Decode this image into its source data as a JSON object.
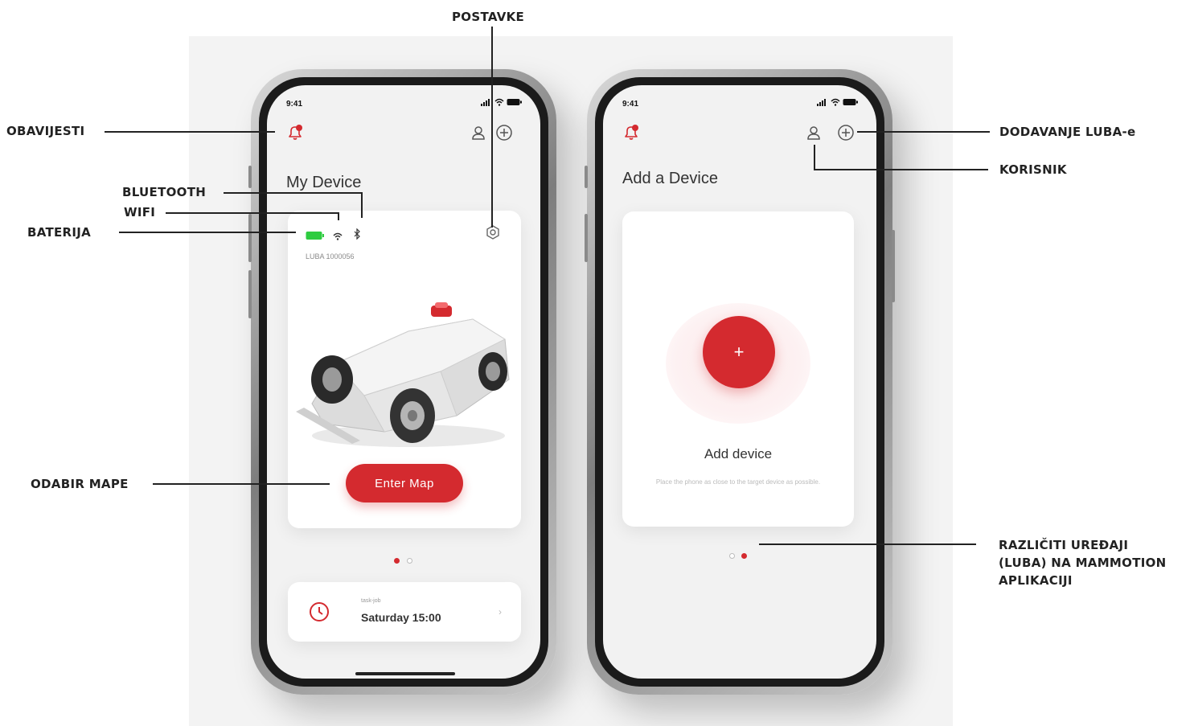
{
  "callouts": {
    "postavke": "POSTAVKE",
    "obavijesti": "OBAVIJESTI",
    "bluetooth": "BLUETOOTH",
    "wifi": "WIFI",
    "baterija": "BATERIJA",
    "odabir_mape": "ODABIR MAPE",
    "dodavanje": "DODAVANJE LUBA-e",
    "korisnik": "KORISNIK",
    "razliciti_line1": "RAZLIČITI UREĐAJI",
    "razliciti_line2": "(LUBA) NA MAMMOTION",
    "razliciti_line3": "APLIKACIJI"
  },
  "left_phone": {
    "status_time": "9:41",
    "title": "My Device",
    "device_name": "LUBA 1000056",
    "enter_map_label": "Enter Map",
    "schedule_task": "task-job",
    "schedule_time": "Saturday 15:00",
    "chevron": "›",
    "page_dots": [
      "active",
      "inactive"
    ]
  },
  "right_phone": {
    "status_time": "9:41",
    "title": "Add a Device",
    "plus_glyph": "+",
    "add_device_label": "Add device",
    "add_device_hint": "Place the phone as close to the target device as possible.",
    "page_dots": [
      "inactive",
      "active"
    ]
  },
  "colors": {
    "accent": "#d42a2f",
    "battery": "#2ecc40",
    "callout_text": "#222222"
  },
  "icons": [
    "bell-icon",
    "user-icon",
    "add-circle-icon",
    "battery-icon",
    "wifi-icon",
    "bluetooth-icon",
    "settings-icon",
    "clock-icon",
    "signal-icon"
  ]
}
